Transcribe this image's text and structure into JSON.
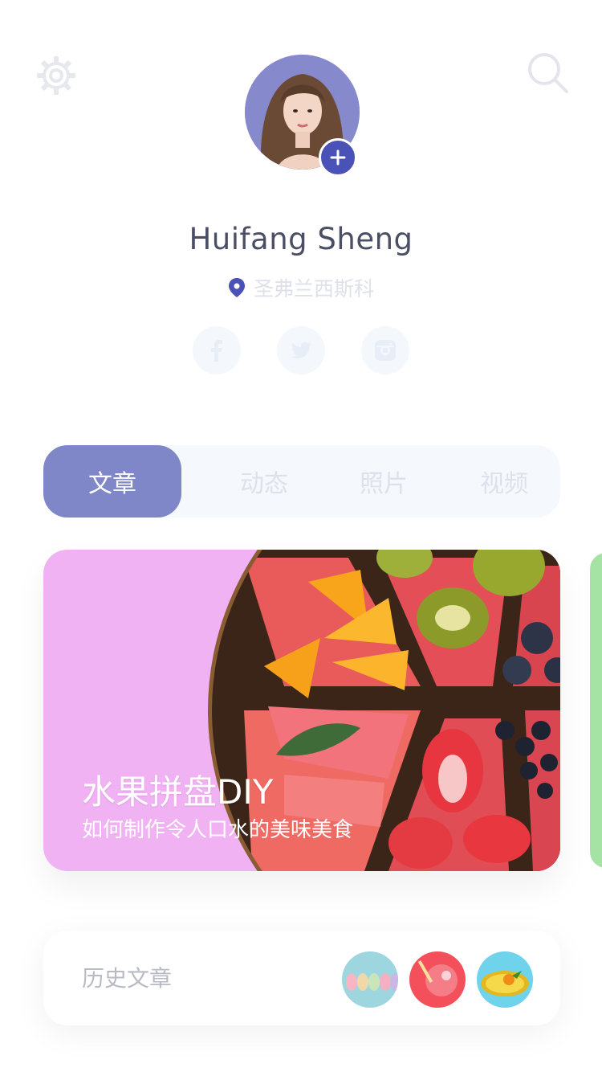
{
  "header": {
    "settings_icon": "gear-icon",
    "search_icon": "search-icon"
  },
  "profile": {
    "name": "Huifang Sheng",
    "location": "圣弗兰西斯科",
    "add_icon": "plus-icon",
    "social": [
      "facebook-icon",
      "twitter-icon",
      "instagram-icon"
    ]
  },
  "tabs": [
    {
      "label": "文章",
      "active": true
    },
    {
      "label": "动态",
      "active": false
    },
    {
      "label": "照片",
      "active": false
    },
    {
      "label": "视频",
      "active": false
    }
  ],
  "featured": {
    "title": "水果拼盘DIY",
    "subtitle": "如何制作令人口水的美味美食"
  },
  "history": {
    "label": "历史文章"
  },
  "colors": {
    "accent": "#7f87c8",
    "add_button": "#4a52b8",
    "card_bg": "#f1b2f4",
    "next_card": "#a5e3a4"
  }
}
